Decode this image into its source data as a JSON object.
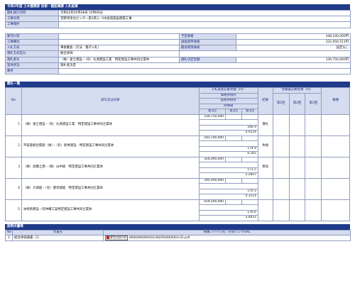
{
  "header": {
    "title": "令和2年度 土木建築部 技術・建設業課 入札結果"
  },
  "info": {
    "rows": [
      {
        "label": "開札執行日時",
        "value": "令和02年05月08日 10時06分"
      },
      {
        "label": "工事名称",
        "value": "宜野湾浄化センター第3系3／4水処理施設建築工事"
      },
      {
        "label": "工事場所",
        "value": ""
      }
    ],
    "split": [
      {
        "label": "路河川等",
        "value": "",
        "label2": "予定価格",
        "value2": "348,100,000円"
      },
      {
        "label": "工事種別",
        "value": "",
        "label2": "調査基準価格",
        "value2": "332,950,511円"
      },
      {
        "label": "入札方式",
        "value": "事後審査（方法：電子入札）",
        "label2": "最低制限価格",
        "value2": "設定なし"
      },
      {
        "label": "落札方式区分",
        "value": "総合評価",
        "label2": "",
        "value2": ""
      },
      {
        "label": "落札者名",
        "value": "（株）富士建設・（有）丸清建設工業　特定建設工事共同企業体",
        "label2": "落札決定金額",
        "value2": "339,750,000円"
      }
    ],
    "tail": [
      {
        "label": "案件状況",
        "value": "落札者決定"
      },
      {
        "label": "備考",
        "value": ""
      }
    ]
  },
  "bids": {
    "section_title": "開札一覧",
    "columns": {
      "no": "No",
      "name": "商号又は名称",
      "amount_group": "入札業者記載金額（円）",
      "price_eval": "価格評価点",
      "tech_eval": "技術評価点",
      "eval_score": "評価値",
      "round1": "第1回",
      "round2": "第2回",
      "round3": "第3回",
      "result": "結果",
      "estimate_group": "見積書記載金額（円）",
      "est1": "第1回",
      "est2": "第2回",
      "est3": "第3回",
      "remarks": "摘要"
    },
    "rows": [
      {
        "no": "1",
        "name": "（株）富士建設・（有）丸清建設工業　特定建設工事共同企業体",
        "amount": "339,750,000",
        "price_eval": "",
        "tech_eval": "166.9",
        "score": "4.9124",
        "result": "落札"
      },
      {
        "no": "2",
        "name": "平安座総合開発（株）・（有）新秀建設　特定建設工事共同企業体",
        "amount": "283,700,000",
        "price_eval": "",
        "tech_eval": "174.9",
        "score": "6.165",
        "result": "失格"
      },
      {
        "no": "3",
        "name": "（株）高橋土建・（株）山中組　特定建設工事共同企業体",
        "amount": "326,000,000",
        "price_eval": "",
        "tech_eval": "171.5",
        "score": "5.2607",
        "result": "無効"
      },
      {
        "no": "4",
        "name": "（株）大城組・（有）豊見建組　特定建設工事共同企業体",
        "amount": "395,000,000",
        "price_eval": "",
        "tech_eval": "170.3",
        "score": "4.3114",
        "result": ""
      },
      {
        "no": "5",
        "name": "洲崎原建設・岡沖縄工設特定建設工事共同企業体",
        "amount": "459,500,000",
        "price_eval": "",
        "tech_eval": "176.6",
        "score": "3.8433",
        "result": ""
      }
    ]
  },
  "docs": {
    "section_title": "説明文書等",
    "columns": {
      "no": "No",
      "name": "文書名",
      "file": "格納ファイル名／外部リンクURL"
    },
    "rows": [
      {
        "no": "1",
        "name": "総合評価調書（1）",
        "button": "ダウンロード",
        "file": "0000000000502392050060003-01.pdf"
      }
    ]
  }
}
